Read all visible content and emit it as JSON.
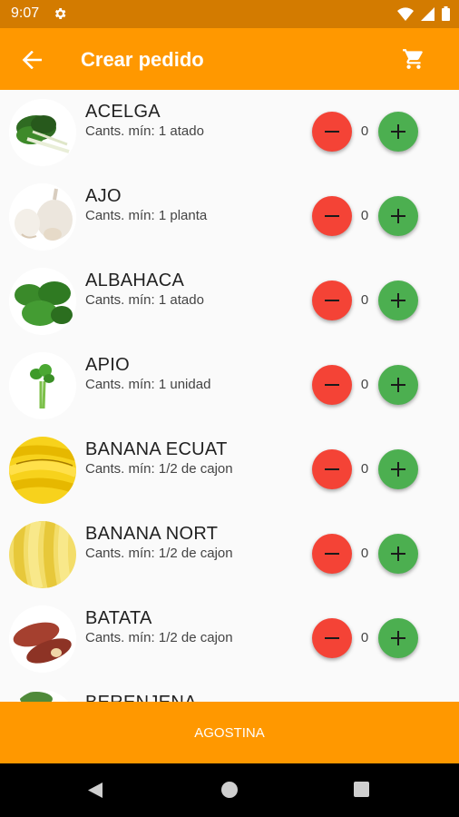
{
  "status_bar": {
    "time": "9:07"
  },
  "app_bar": {
    "title": "Crear pedido"
  },
  "products": [
    {
      "name": "ACELGA",
      "min": "Cants. mín: 1 atado",
      "qty": "0",
      "image": "chard"
    },
    {
      "name": "AJO",
      "min": "Cants. mín: 1 planta",
      "qty": "0",
      "image": "garlic"
    },
    {
      "name": "ALBAHACA",
      "min": "Cants. mín: 1 atado",
      "qty": "0",
      "image": "basil"
    },
    {
      "name": "APIO",
      "min": "Cants. mín: 1 unidad",
      "qty": "0",
      "image": "celery"
    },
    {
      "name": "BANANA ECUAT",
      "min": "Cants. mín: 1/2 de cajon",
      "qty": "0",
      "image": "bananas"
    },
    {
      "name": "BANANA NORT",
      "min": "Cants. mín: 1/2 de cajon",
      "qty": "0",
      "image": "bananas-2"
    },
    {
      "name": "BATATA",
      "min": "Cants. mín: 1/2 de cajon",
      "qty": "0",
      "image": "sweet-potato"
    },
    {
      "name": "BERENJENA",
      "min": "",
      "qty": "",
      "image": "eggplant"
    }
  ],
  "bottom_bar": {
    "label": "AGOSTINA"
  },
  "colors": {
    "primary": "#ff9800",
    "status": "#d37b00",
    "minus": "#f44336",
    "plus": "#4caf50"
  }
}
